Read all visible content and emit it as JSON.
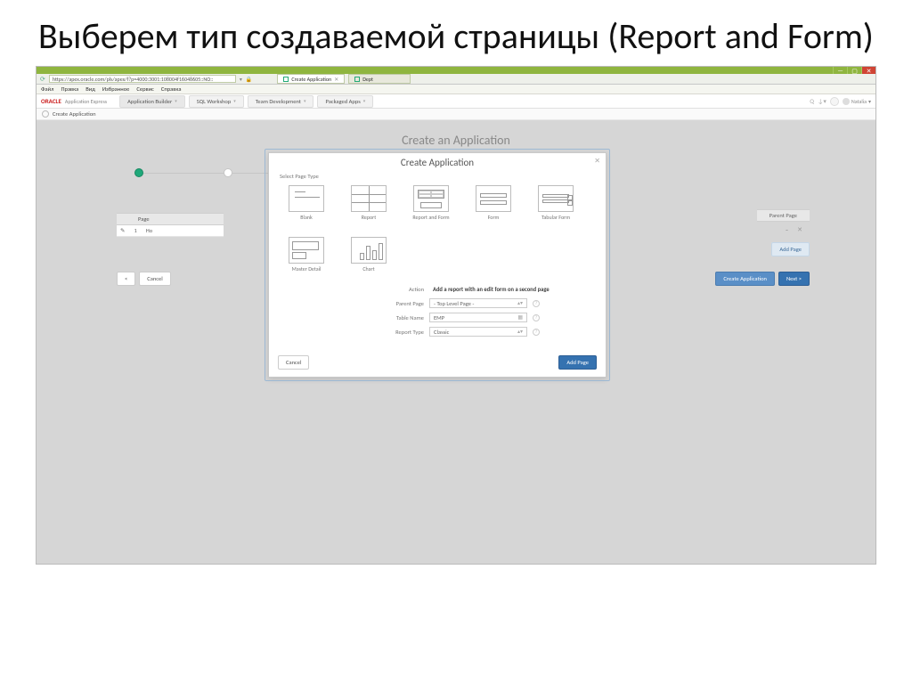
{
  "slide": {
    "title": "Выберем тип создаваемой страницы (Report and Form)"
  },
  "browser": {
    "url": "https://apex.oracle.com/pls/apex/f?p=4000:3001:108004f16048605::NO::",
    "tabs": [
      {
        "label": "Create Application"
      },
      {
        "label": "Dept"
      }
    ],
    "menus": [
      "Файл",
      "Правка",
      "Вид",
      "Избранное",
      "Сервис",
      "Справка"
    ],
    "window_controls": {
      "min": "—",
      "max": "▢",
      "close": "✕"
    }
  },
  "app": {
    "brand": "ORACLE",
    "brand_sub": "Application Express",
    "nav": [
      "Application Builder",
      "SQL Workshop",
      "Team Development",
      "Packaged Apps"
    ],
    "user": "Natalia",
    "breadcrumb": "Create Application"
  },
  "page": {
    "heading": "Create an Application",
    "table": {
      "col_page": "Page",
      "col_num": "1",
      "col_name": "Ho",
      "icon": "✎"
    },
    "right": {
      "col_parent": "Parent Page",
      "dash": "–",
      "x": "✕",
      "add_page": "Add Page"
    },
    "buttons": {
      "back": "<",
      "cancel": "Cancel",
      "create": "Create Application",
      "next": "Next >"
    }
  },
  "modal": {
    "title": "Create Application",
    "close": "✕",
    "section": "Select Page Type",
    "tiles": [
      {
        "label": "Blank"
      },
      {
        "label": "Report"
      },
      {
        "label": "Report and Form"
      },
      {
        "label": "Form"
      },
      {
        "label": "Tabular Form"
      },
      {
        "label": "Master Detail"
      },
      {
        "label": "Chart"
      }
    ],
    "form": {
      "action_label": "Action",
      "action_value": "Add a report with an edit form on a second page",
      "parent_label": "Parent Page",
      "parent_value": "- Top Level Page -",
      "table_label": "Table Name",
      "table_value": "EMP",
      "report_label": "Report Type",
      "report_value": "Classic"
    },
    "buttons": {
      "cancel": "Cancel",
      "add": "Add Page"
    }
  }
}
